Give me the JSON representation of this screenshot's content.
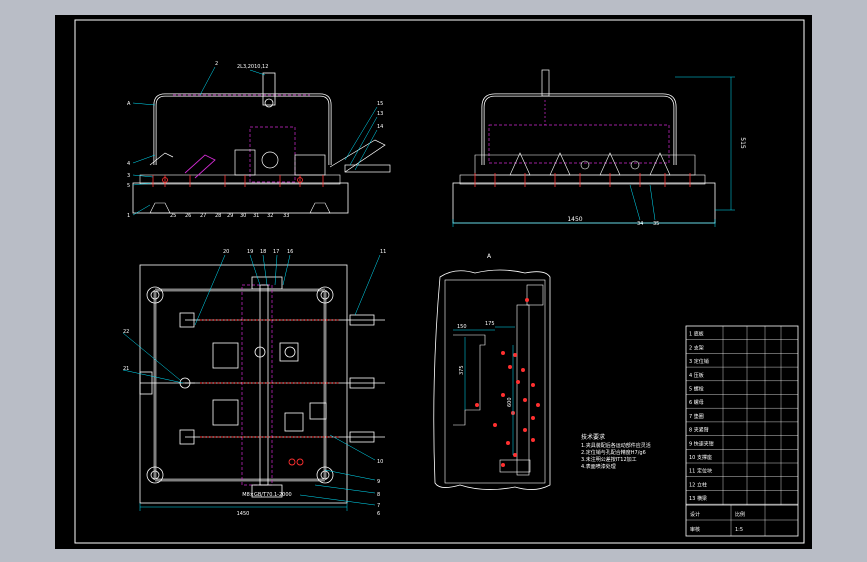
{
  "sheet": {
    "background": "#000000",
    "frame_color": "#ffffff",
    "line_colors": {
      "outline": "#ffffff",
      "pipe": "#ffffff",
      "dims": "#00e5ff",
      "hidden": "#d22bd2",
      "bolts": "#ff3030"
    }
  },
  "front_view": {
    "labels": [
      "2",
      "A",
      "2L3,2010,12",
      "15",
      "13",
      "14",
      "4",
      "3",
      "5",
      "1",
      "25",
      "26",
      "27",
      "28",
      "29",
      "30",
      "31",
      "32",
      "33"
    ]
  },
  "side_view": {
    "dimension_width": "1450",
    "dimension_height": "515",
    "labels": [
      "34",
      "35"
    ]
  },
  "top_view": {
    "dimension_width": "1450",
    "labels": [
      "20",
      "19",
      "18",
      "17",
      "22",
      "21",
      "16",
      "11",
      "10",
      "9",
      "8",
      "7",
      "6"
    ],
    "bottom_note": "M8×GB/T70.1-2000"
  },
  "detail_view": {
    "title": "A",
    "dims": [
      "150",
      "175",
      "375",
      "600"
    ]
  },
  "notes": {
    "title": "技术要求",
    "lines": [
      "1.夹具装配后各运动部件应灵活",
      "2.定位销与孔配合精度H7/g6",
      "3.未注明公差按IT12加工",
      "4.表面喷漆处理"
    ]
  },
  "title_block": {
    "rows": [
      "1 底板",
      "2 支架",
      "3 定位销",
      "4 压板",
      "5 螺栓",
      "6 螺母",
      "7 垫圈",
      "8 夹紧臂",
      "9 快速夹钳",
      "10 支撑座",
      "11 定位块",
      "12 立柱",
      "13 横梁"
    ],
    "footer": [
      "设计",
      "审核",
      "比例",
      "1:5"
    ]
  }
}
